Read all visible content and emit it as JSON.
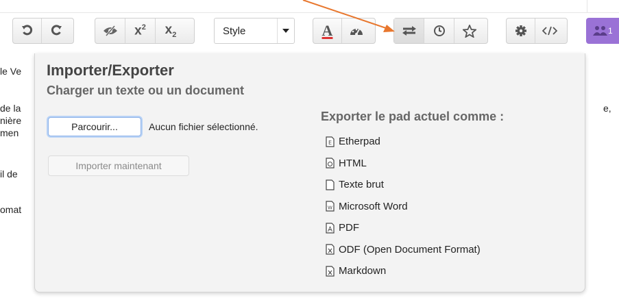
{
  "toolbar": {
    "groups": [
      {
        "items": [
          {
            "icon": "undo-icon"
          },
          {
            "icon": "redo-icon"
          }
        ]
      },
      {
        "items": [
          {
            "icon": "eye-slash-icon"
          },
          {
            "icon": "superscript-icon",
            "label": "x²"
          },
          {
            "icon": "subscript-icon",
            "label": "x₂"
          }
        ]
      },
      {
        "items": [
          {
            "icon": "text-color-icon",
            "label": "A"
          },
          {
            "icon": "dashboard-icon"
          }
        ]
      },
      {
        "items": [
          {
            "icon": "import-export-icon"
          },
          {
            "icon": "history-clock-icon"
          },
          {
            "icon": "star-icon"
          }
        ]
      },
      {
        "items": [
          {
            "icon": "gear-icon"
          },
          {
            "icon": "embed-code-icon"
          }
        ]
      }
    ],
    "style_select": {
      "value": "Style"
    },
    "users": {
      "count": "1",
      "color": "#9a72d6"
    }
  },
  "background_text": [
    "le Ve",
    "de la",
    "nière",
    "men",
    "il de",
    "omat",
    "e,"
  ],
  "panel": {
    "title": "Importer/Exporter",
    "import_subtitle": "Charger un texte ou un document",
    "file_button": "Parcourir...",
    "file_status": "Aucun fichier sélectionné.",
    "import_button": "Importer maintenant",
    "export_title": "Exporter le pad actuel comme :",
    "export_options": [
      {
        "label": "Etherpad",
        "icon": "etherpad-file-icon"
      },
      {
        "label": "HTML",
        "icon": "html-file-icon"
      },
      {
        "label": "Texte brut",
        "icon": "plain-text-file-icon"
      },
      {
        "label": "Microsoft Word",
        "icon": "word-file-icon"
      },
      {
        "label": "PDF",
        "icon": "pdf-file-icon"
      },
      {
        "label": "ODF (Open Document Format)",
        "icon": "odf-file-icon"
      },
      {
        "label": "Markdown",
        "icon": "markdown-file-icon"
      }
    ]
  },
  "annotation": {
    "color": "#e8772e"
  }
}
